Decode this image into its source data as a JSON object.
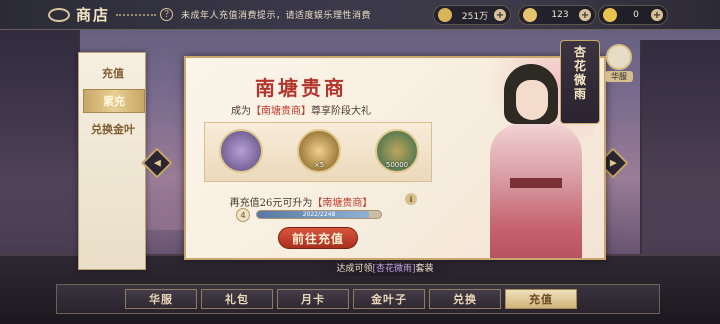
{
  "topbar": {
    "title": "商店",
    "notice": "未成年人充值消费提示，请适度娱乐理性消费",
    "currencies": [
      {
        "icon": "gold-coin-icon",
        "value": "251万",
        "color": "#d9b45a"
      },
      {
        "icon": "gold-leaf-icon",
        "value": "123",
        "color": "#e6c46e"
      },
      {
        "icon": "gold-ingot-icon",
        "value": "0",
        "color": "#e9c34f"
      }
    ]
  },
  "sidebar": {
    "items": [
      {
        "label": "充值",
        "active": false
      },
      {
        "label": "累充",
        "active": true
      },
      {
        "label": "兑换金叶",
        "active": false
      }
    ]
  },
  "card": {
    "title": "南塘贵商",
    "subtitle_prefix": "成为",
    "subtitle_highlight": "【南塘贵商】",
    "subtitle_suffix": "尊享阶段大礼",
    "rewards": [
      {
        "icon": "outfit-icon",
        "quantity": "",
        "color": "#5a4a7a"
      },
      {
        "icon": "gold-ingot-icon",
        "quantity": "×5",
        "color": "#7c5a1e"
      },
      {
        "icon": "copper-coin-icon",
        "quantity": "50000",
        "color": "#2f6b4c"
      }
    ],
    "upgrade_prefix": "再充值26元可升为",
    "upgrade_highlight": "【南塘贵商】",
    "level": "4",
    "progress_text": "2022/2248",
    "progress_fraction": 0.9,
    "go_button": "前往充值"
  },
  "character": {
    "name_vertical": [
      "杏",
      "花",
      "微",
      "雨"
    ],
    "dress_label": "华服"
  },
  "banner": {
    "prefix": "达成可领",
    "highlight": "[杏花微雨]",
    "suffix": "套装"
  },
  "bottom_tabs": [
    {
      "label": "华服",
      "active": false
    },
    {
      "label": "礼包",
      "active": false
    },
    {
      "label": "月卡",
      "active": false
    },
    {
      "label": "金叶子",
      "active": false
    },
    {
      "label": "兑换",
      "active": false
    },
    {
      "label": "充值",
      "active": true
    }
  ]
}
